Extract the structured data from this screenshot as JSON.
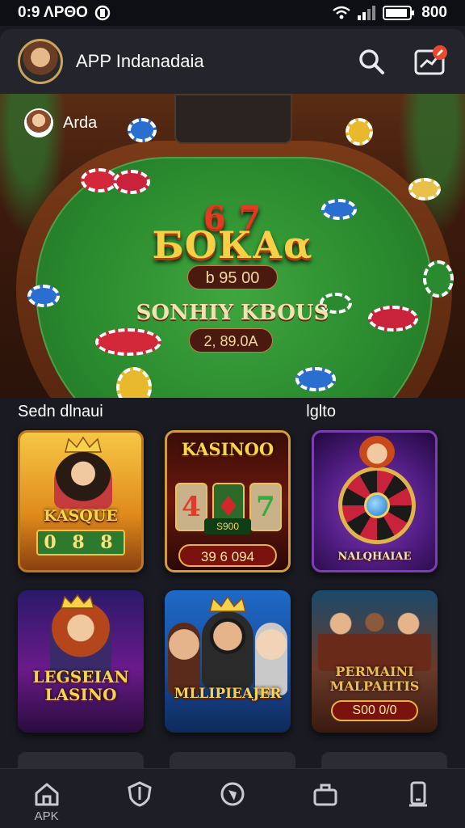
{
  "status_bar": {
    "time": "0:9 ΛΡΘΟ",
    "battery": "800"
  },
  "header": {
    "title": "APP Indanadaia"
  },
  "hero": {
    "user_name": "Arda",
    "headline_top": "6 7",
    "headline": "БОКАα",
    "jackpot": "b 95 00",
    "subtitle": "SONHIY KBOUS",
    "amount": "2, 89.0A"
  },
  "sections": {
    "left_label": "Sedn dlnaui",
    "right_label": "lglto"
  },
  "games": [
    {
      "title": "KASQUE",
      "extra": "0 8 8",
      "amount": ""
    },
    {
      "title": "KASINOO",
      "extra": "S900",
      "amount": "39 6 094"
    },
    {
      "title": "NALQHAIAE",
      "extra": "",
      "amount": ""
    },
    {
      "title": "LEGSEIAN LASINO",
      "extra": "",
      "amount": ""
    },
    {
      "title": "MLLIPIEAJER",
      "extra": "",
      "amount": ""
    },
    {
      "title": "PERMAINI MALPAHTIS",
      "extra": "",
      "amount": "S00 0/0"
    }
  ],
  "nav": [
    {
      "label": "APK",
      "icon": "home-icon"
    },
    {
      "label": "",
      "icon": "shield-icon"
    },
    {
      "label": "",
      "icon": "compass-icon"
    },
    {
      "label": "",
      "icon": "bag-icon"
    },
    {
      "label": "",
      "icon": "phone-icon"
    }
  ],
  "colors": {
    "accent_gold": "#f6d548",
    "felt_green": "#2a8a2e",
    "background": "#1a1b22",
    "notification": "#e8492f"
  }
}
